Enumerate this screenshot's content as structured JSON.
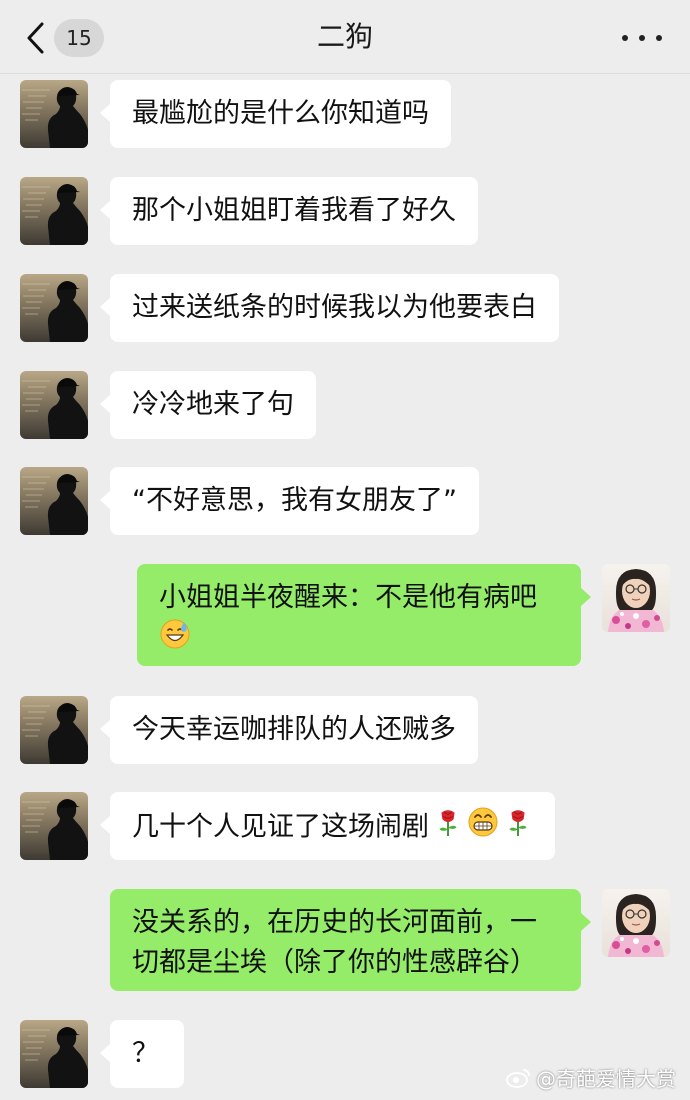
{
  "header": {
    "back_badge": "15",
    "title": "二狗"
  },
  "messages": [
    {
      "side": "in",
      "text": "最尴尬的是什么你知道吗"
    },
    {
      "side": "in",
      "text": "那个小姐姐盯着我看了好久"
    },
    {
      "side": "in",
      "text": "过来送纸条的时候我以为他要表白"
    },
    {
      "side": "in",
      "text": "冷冷地来了句"
    },
    {
      "side": "in",
      "text": "“不好意思，我有女朋友了”"
    },
    {
      "side": "out",
      "text": "小姐姐半夜醒来：不是他有病吧",
      "emoji": [
        "sweat-smile-emoji"
      ]
    },
    {
      "side": "in",
      "text": "今天幸运咖排队的人还贼多"
    },
    {
      "side": "in",
      "text": "几十个人见证了这场闹剧",
      "emoji": [
        "rose-emoji",
        "grin-emoji",
        "rose-emoji"
      ]
    },
    {
      "side": "out",
      "text": "没关系的，在历史的长河面前，一切都是尘埃（除了你的性感辟谷）"
    },
    {
      "side": "in",
      "text": "？"
    }
  ],
  "watermark": "@奇葩爱情大赏",
  "colors": {
    "background": "#ededed",
    "incoming_bubble": "#ffffff",
    "outgoing_bubble": "#95ec69"
  }
}
